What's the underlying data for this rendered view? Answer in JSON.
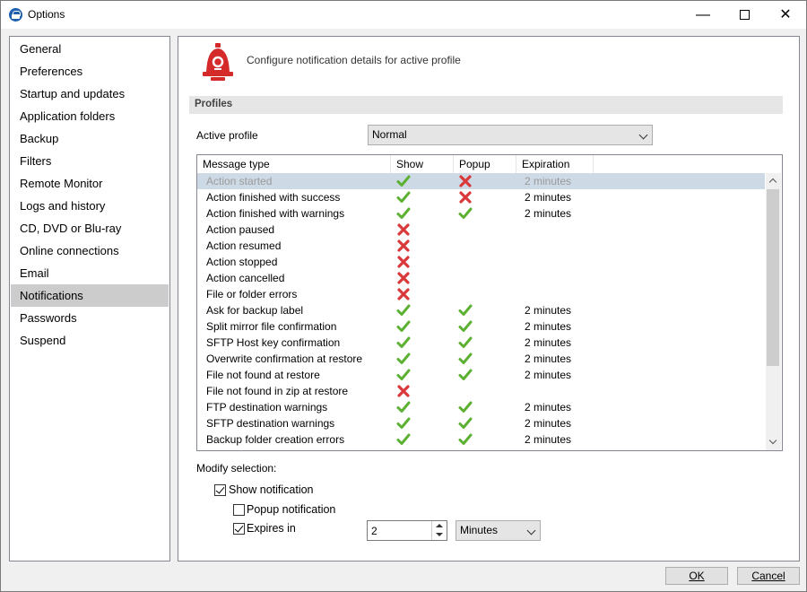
{
  "window": {
    "title": "Options"
  },
  "nav": {
    "items": [
      "General",
      "Preferences",
      "Startup and updates",
      "Application folders",
      "Backup",
      "Filters",
      "Remote Monitor",
      "Logs and history",
      "CD, DVD or Blu-ray",
      "Online connections",
      "Email",
      "Notifications",
      "Passwords",
      "Suspend"
    ],
    "selected": "Notifications"
  },
  "header": {
    "text": "Configure notification details for active profile",
    "icon": "bell-icon"
  },
  "profiles": {
    "section_title": "Profiles",
    "active_label": "Active profile",
    "active_value": "Normal"
  },
  "table": {
    "columns": [
      "Message type",
      "Show",
      "Popup",
      "Expiration"
    ],
    "rows": [
      {
        "type": "Action started",
        "show": true,
        "popup": false,
        "expiration": "2 minutes",
        "selected": true
      },
      {
        "type": "Action finished with success",
        "show": true,
        "popup": false,
        "expiration": "2 minutes"
      },
      {
        "type": "Action finished with warnings",
        "show": true,
        "popup": true,
        "expiration": "2 minutes"
      },
      {
        "type": "Action paused",
        "show": false,
        "popup": null,
        "expiration": ""
      },
      {
        "type": "Action resumed",
        "show": false,
        "popup": null,
        "expiration": ""
      },
      {
        "type": "Action stopped",
        "show": false,
        "popup": null,
        "expiration": ""
      },
      {
        "type": "Action cancelled",
        "show": false,
        "popup": null,
        "expiration": ""
      },
      {
        "type": "File or folder errors",
        "show": false,
        "popup": null,
        "expiration": ""
      },
      {
        "type": "Ask for backup label",
        "show": true,
        "popup": true,
        "expiration": "2 minutes"
      },
      {
        "type": "Split mirror file confirmation",
        "show": true,
        "popup": true,
        "expiration": "2 minutes"
      },
      {
        "type": "SFTP Host key confirmation",
        "show": true,
        "popup": true,
        "expiration": "2 minutes"
      },
      {
        "type": "Overwrite confirmation at restore",
        "show": true,
        "popup": true,
        "expiration": "2 minutes"
      },
      {
        "type": "File not found at restore",
        "show": true,
        "popup": true,
        "expiration": "2 minutes"
      },
      {
        "type": "File not found in zip at restore",
        "show": false,
        "popup": null,
        "expiration": ""
      },
      {
        "type": "FTP destination warnings",
        "show": true,
        "popup": true,
        "expiration": "2 minutes"
      },
      {
        "type": "SFTP destination warnings",
        "show": true,
        "popup": true,
        "expiration": "2 minutes"
      },
      {
        "type": "Backup folder creation errors",
        "show": true,
        "popup": true,
        "expiration": "2 minutes"
      }
    ]
  },
  "modify": {
    "label": "Modify selection:",
    "show_notification": {
      "label": "Show notification",
      "checked": true
    },
    "popup_notification": {
      "label": "Popup notification",
      "checked": false
    },
    "expires_in": {
      "label": "Expires in",
      "checked": true,
      "value": "2",
      "unit": "Minutes"
    }
  },
  "buttons": {
    "ok": "OK",
    "cancel": "Cancel"
  },
  "colors": {
    "check": "#5cb032",
    "cross": "#d9393a",
    "selected_row": "#cdd9e5",
    "bell": "#d42a2a"
  }
}
